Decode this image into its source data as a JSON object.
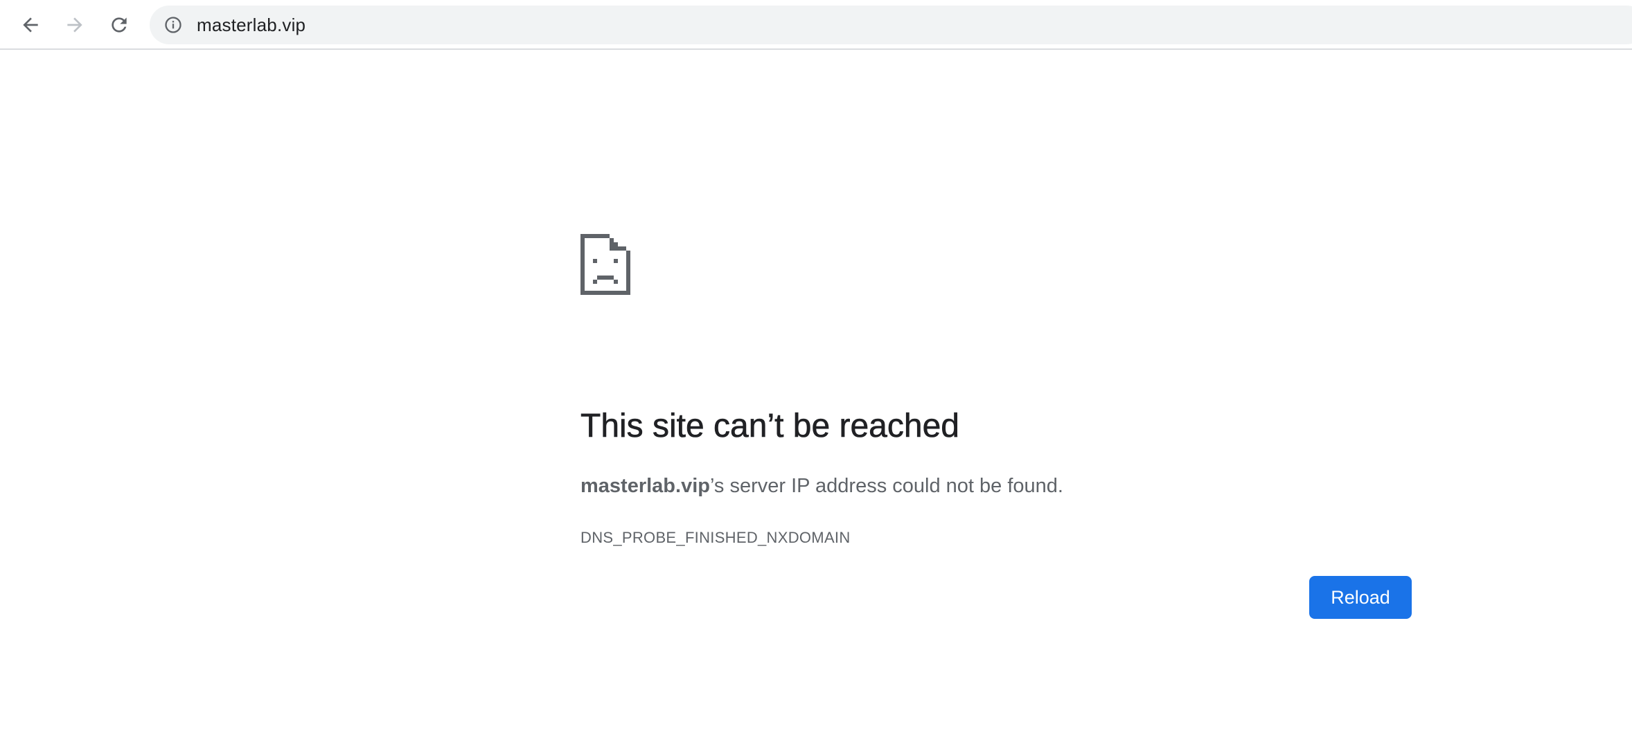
{
  "browser": {
    "url": "masterlab.vip",
    "icons": {
      "back": "arrow-left-icon",
      "forward": "arrow-right-icon",
      "reload": "reload-icon",
      "site_info": "info-icon"
    }
  },
  "error_page": {
    "icon": "sad-document-icon",
    "headline": "This site can’t be reached",
    "host": "masterlab.vip",
    "message_suffix": "’s server IP address could not be found.",
    "error_code": "DNS_PROBE_FINISHED_NXDOMAIN",
    "reload_label": "Reload"
  },
  "colors": {
    "accent": "#1a73e8",
    "headline": "#202124",
    "body_text": "#5f6368",
    "omnibox_bg": "#f1f3f4",
    "icon": "#5f6368"
  }
}
